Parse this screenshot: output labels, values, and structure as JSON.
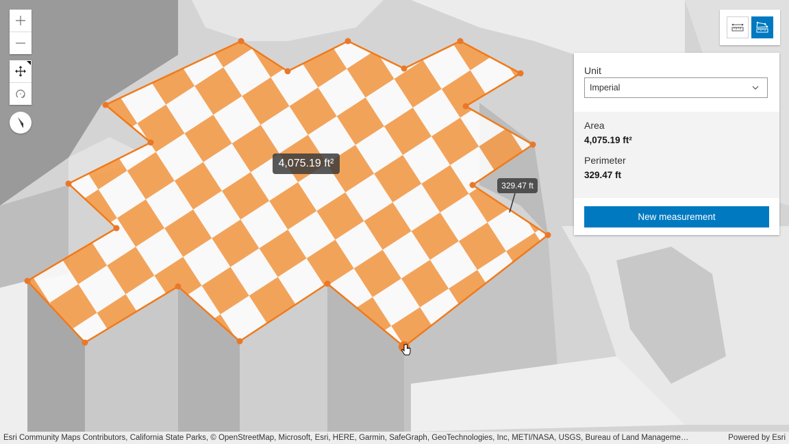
{
  "view": {
    "zoom_in_label": "+",
    "zoom_out_label": "−",
    "navigation_controls": [
      "zoom-in",
      "zoom-out",
      "pan",
      "rotate",
      "compass"
    ]
  },
  "measurement_tools": {
    "distance_tool": {
      "icon": "distance-measurement-icon",
      "active": false
    },
    "area_tool": {
      "icon": "area-measurement-icon",
      "active": true
    }
  },
  "panel": {
    "unit_label": "Unit",
    "unit_value": "Imperial",
    "area_label": "Area",
    "area_value": "4,075.19 ft²",
    "perimeter_label": "Perimeter",
    "perimeter_value": "329.47 ft",
    "new_measurement_label": "New measurement"
  },
  "map_labels": {
    "area": "4,075.19 ft²",
    "perimeter": "329.47 ft"
  },
  "colors": {
    "accent": "#0079c1",
    "measurement_fill": "#ff8a1f",
    "measurement_line": "#f07a1a"
  },
  "attribution": {
    "text": "Esri Community Maps Contributors, California State Parks, © OpenStreetMap, Microsoft, Esri, HERE, Garmin, SafeGraph, GeoTechnologies, Inc, METI/NASA, USGS, Bureau of Land Manageme…",
    "powered_by": "Powered by Esri"
  }
}
